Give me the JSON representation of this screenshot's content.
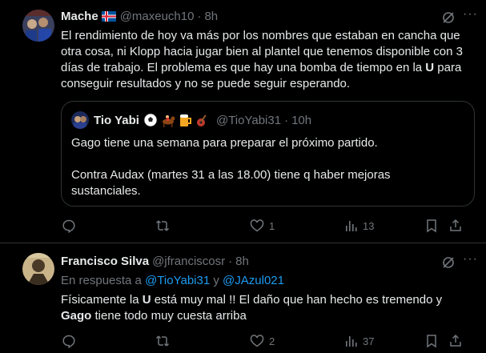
{
  "tweet1": {
    "name": "Mache",
    "handle": "@maxeuch10",
    "time": "8h",
    "text_line1": "El rendimiento de hoy va más por los nombres que estaban en cancha que",
    "text_line2": "otra cosa, ni Klopp hacia jugar bien al plantel que tenemos disponible con 3",
    "text_line3_a": "días de trabajo. El problema es que hay una bomba de tiempo en la ",
    "text_line3_b": "U",
    "text_line3_c": " para",
    "text_line4": "conseguir resultados y no se puede seguir esperando.",
    "quote": {
      "name": "Tio Yabi",
      "handle": "@TioYabi31",
      "time": "10h",
      "emojis": [
        "soccer-ball-icon",
        "horse-racing-icon",
        "beer-icon",
        "guitar-icon"
      ],
      "line1": "Gago tiene una semana para preparar el próximo partido.",
      "line2": "Contra Audax (martes 31 a las 18.00) tiene q haber mejoras",
      "line3": "sustanciales."
    },
    "actions": {
      "reply_count": "",
      "retweet_count": "",
      "like_count": "1",
      "views_count": "13"
    }
  },
  "tweet2": {
    "name": "Francisco Silva",
    "handle": "@jfranciscosr",
    "time": "8h",
    "reply_prefix": "En respuesta a ",
    "reply_user1": "@TioYabi31",
    "reply_and": " y ",
    "reply_user2": "@JAzul021",
    "line1_a": "Físicamente la ",
    "line1_b": "U",
    "line1_c": " está muy mal !! El daño que han hecho es tremendo y",
    "line2_a": "Gago",
    "line2_b": " tiene todo muy cuesta arriba",
    "actions": {
      "reply_count": "",
      "retweet_count": "",
      "like_count": "2",
      "views_count": "37"
    }
  }
}
